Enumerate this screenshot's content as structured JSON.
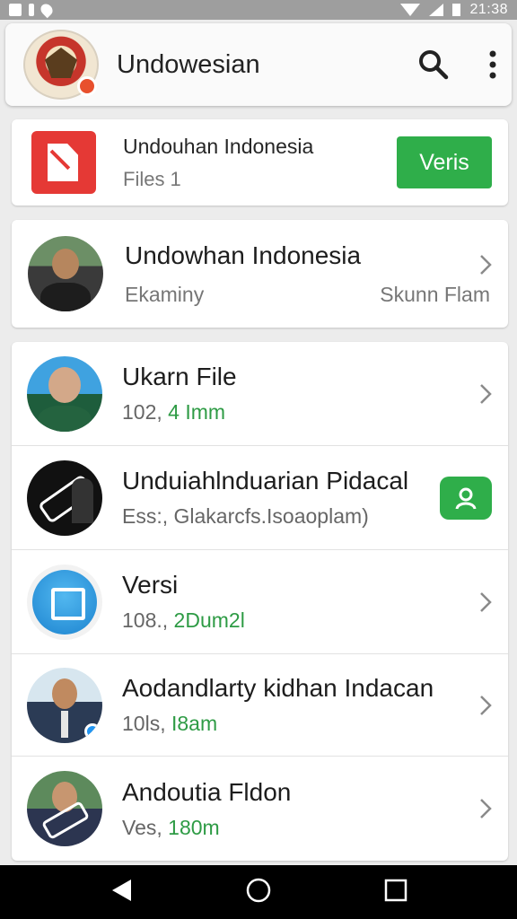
{
  "status_bar": {
    "time": "21:38"
  },
  "app_bar": {
    "title": "Undowesian"
  },
  "download_card": {
    "title": "Undouhan Indonesia",
    "subtitle": "Files 1",
    "button_label": "Veris"
  },
  "profile_card": {
    "title": "Undowhan Indonesia",
    "left_meta": "Ekaminy",
    "right_meta": "Skunn Flam"
  },
  "list": [
    {
      "title": "Ukarn File",
      "sub_prefix": "102, ",
      "sub_highlight": "4 Imm"
    },
    {
      "title": "Unduiahlnduarian Pidacal",
      "sub_prefix": "Ess:, Glakarcfs.Isoaoplam)",
      "sub_highlight": ""
    },
    {
      "title": "Versi",
      "sub_prefix": "108., ",
      "sub_highlight": "2Dum2l"
    },
    {
      "title": "Aodandlarty kidhan Indacan",
      "sub_prefix": "10ls, ",
      "sub_highlight": "I8am"
    },
    {
      "title": "Andoutia Fldon",
      "sub_prefix": "Ves, ",
      "sub_highlight": "180m"
    }
  ],
  "colors": {
    "accent_green": "#2fae4a",
    "download_red": "#e53935",
    "highlight_text_green": "#2e9b45"
  },
  "icons": [
    "search-icon",
    "more-vert-icon",
    "chevron-right-icon",
    "person-icon",
    "back-icon",
    "home-icon",
    "recents-icon"
  ]
}
